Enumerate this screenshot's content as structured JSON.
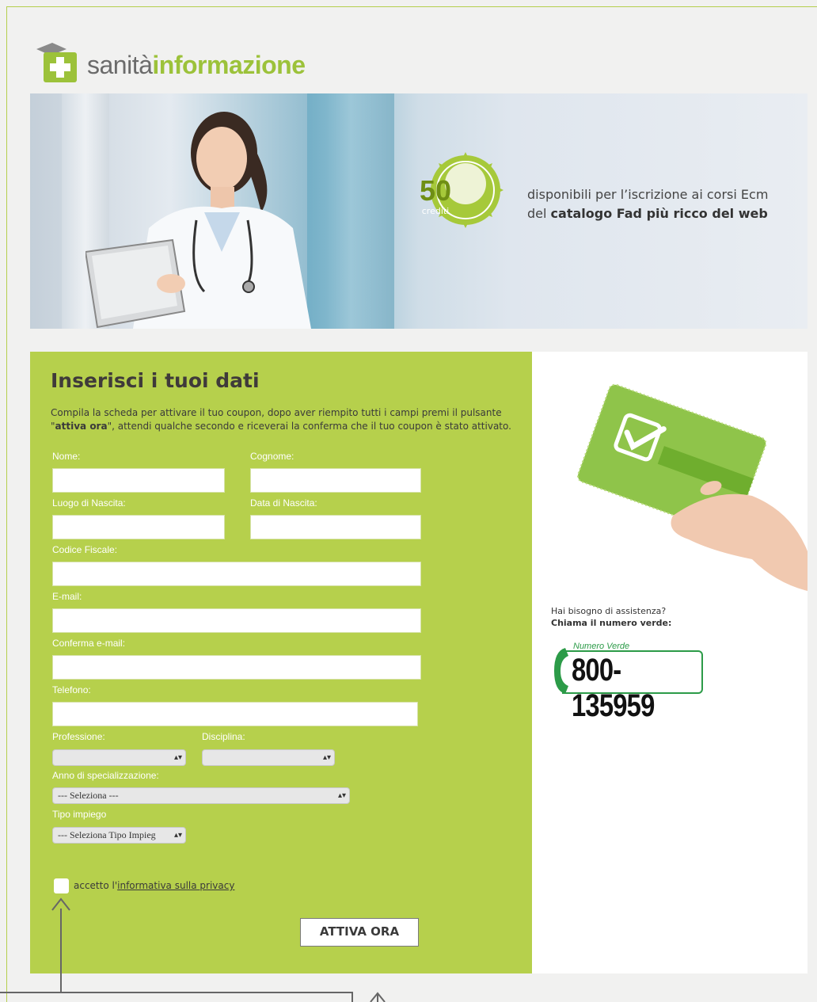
{
  "brand": {
    "part1": "sanità",
    "part2": "informazione"
  },
  "banner": {
    "badge_number": "50",
    "badge_label": "crediti",
    "line1": "disponibili per l’iscrizione ai corsi Ecm",
    "line2_prefix": "del ",
    "line2_bold": "catalogo Fad più ricco del web"
  },
  "form": {
    "title": "Inserisci i tuoi dati",
    "intro_1": "Compila la scheda per attivare il tuo coupon, dopo aver riempito tutti i campi premi il pulsante",
    "intro_2_q1": "\"",
    "intro_2_bold": "attiva ora",
    "intro_2_rest": "\", attendi qualche secondo e riceverai la conferma che il tuo coupon è stato attivato.",
    "labels": {
      "nome": "Nome:",
      "cognome": "Cognome:",
      "luogo": "Luogo di Nascita:",
      "data": "Data di Nascita:",
      "cf": "Codice Fiscale:",
      "email": "E-mail:",
      "conferma": "Conferma e-mail:",
      "telefono": "Telefono:",
      "professione": "Professione:",
      "disciplina": "Disciplina:",
      "anno": "Anno di specializzazione:",
      "tipo": "Tipo impiego"
    },
    "values": {
      "nome": "",
      "cognome": "",
      "luogo": "",
      "data": "",
      "cf": "",
      "email": "",
      "conferma": "",
      "telefono": ""
    },
    "selects": {
      "professione": "",
      "disciplina": "",
      "anno": "--- Seleziona ---",
      "tipo": "--- Seleziona Tipo Impieg"
    },
    "privacy_prefix": "accetto l'",
    "privacy_link": "informativa sulla privacy",
    "submit": "ATTIVA ORA"
  },
  "side": {
    "help_line1": "Hai bisogno di assistenza?",
    "help_line2": "Chiama il numero verde:",
    "numero_verde_label": "Numero Verde",
    "numero_verde": "800-135959"
  },
  "colors": {
    "accent": "#b6d04c",
    "brand_green": "#9cc23a",
    "verde": "#2c9b48"
  }
}
